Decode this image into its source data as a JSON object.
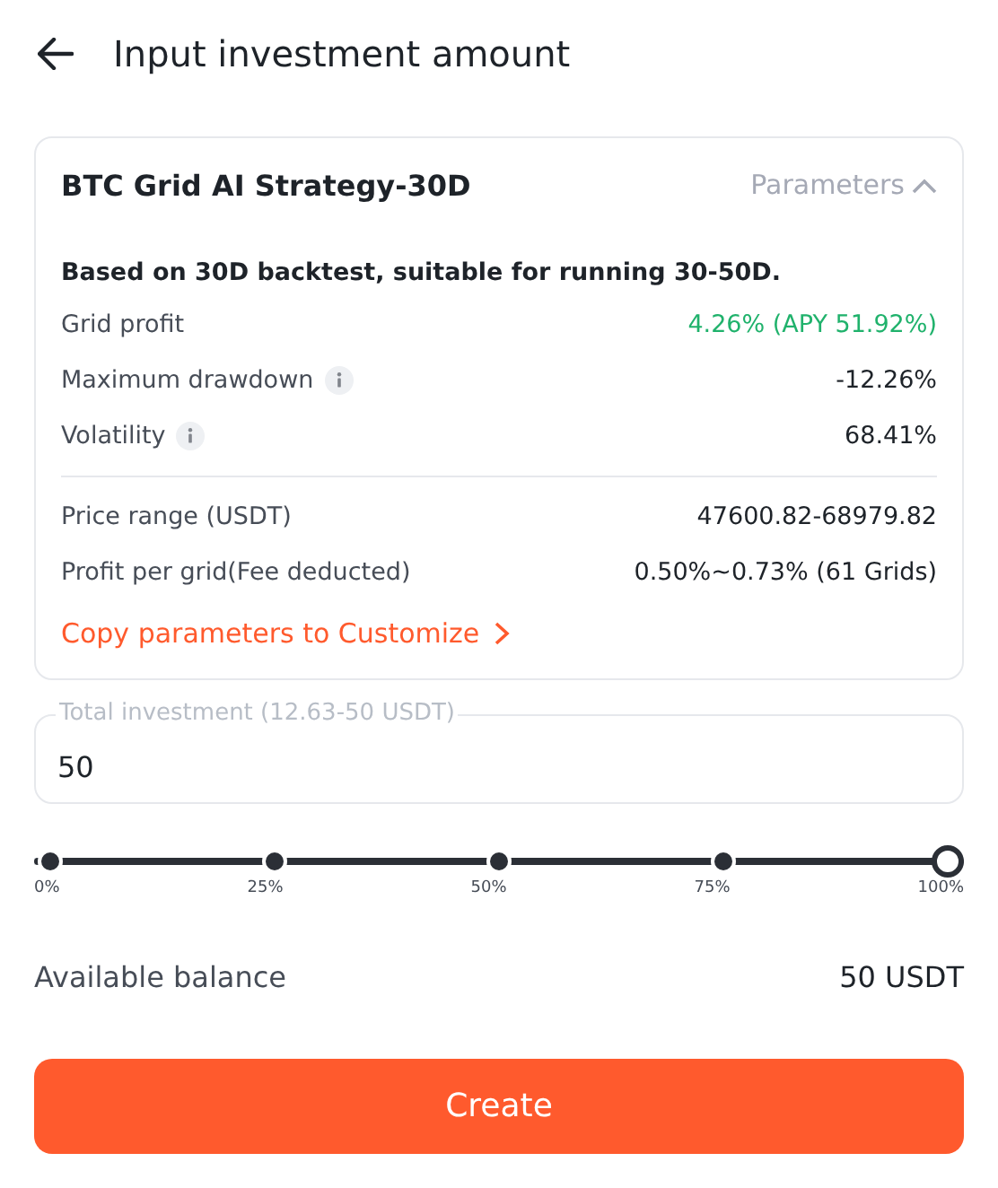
{
  "header": {
    "title": "Input investment amount"
  },
  "strategy": {
    "title": "BTC Grid AI Strategy-30D",
    "toggle": {
      "label": "Parameters",
      "expanded": true
    },
    "description": "Based on 30D backtest, suitable for running 30-50D.",
    "stats": [
      {
        "label": "Grid profit",
        "value": "4.26% (APY 51.92%)",
        "info": false,
        "highlight": true
      },
      {
        "label": "Maximum drawdown",
        "value": "-12.26%",
        "info": true,
        "highlight": false
      },
      {
        "label": "Volatility",
        "value": "68.41%",
        "info": true,
        "highlight": false
      }
    ],
    "ranges": [
      {
        "label": "Price range (USDT)",
        "value": "47600.82-68979.82"
      },
      {
        "label": "Profit per grid(Fee deducted)",
        "value": "0.50%~0.73% (61 Grids)"
      }
    ],
    "link": "Copy parameters to Customize"
  },
  "investment": {
    "label": "Total investment (12.63-50 USDT)",
    "value": "50"
  },
  "slider": {
    "level": 1.0,
    "ticks": [
      "0%",
      "25%",
      "50%",
      "75%",
      "100%"
    ]
  },
  "balance": {
    "label": "Available balance",
    "value": "50 USDT"
  },
  "button": "Create"
}
